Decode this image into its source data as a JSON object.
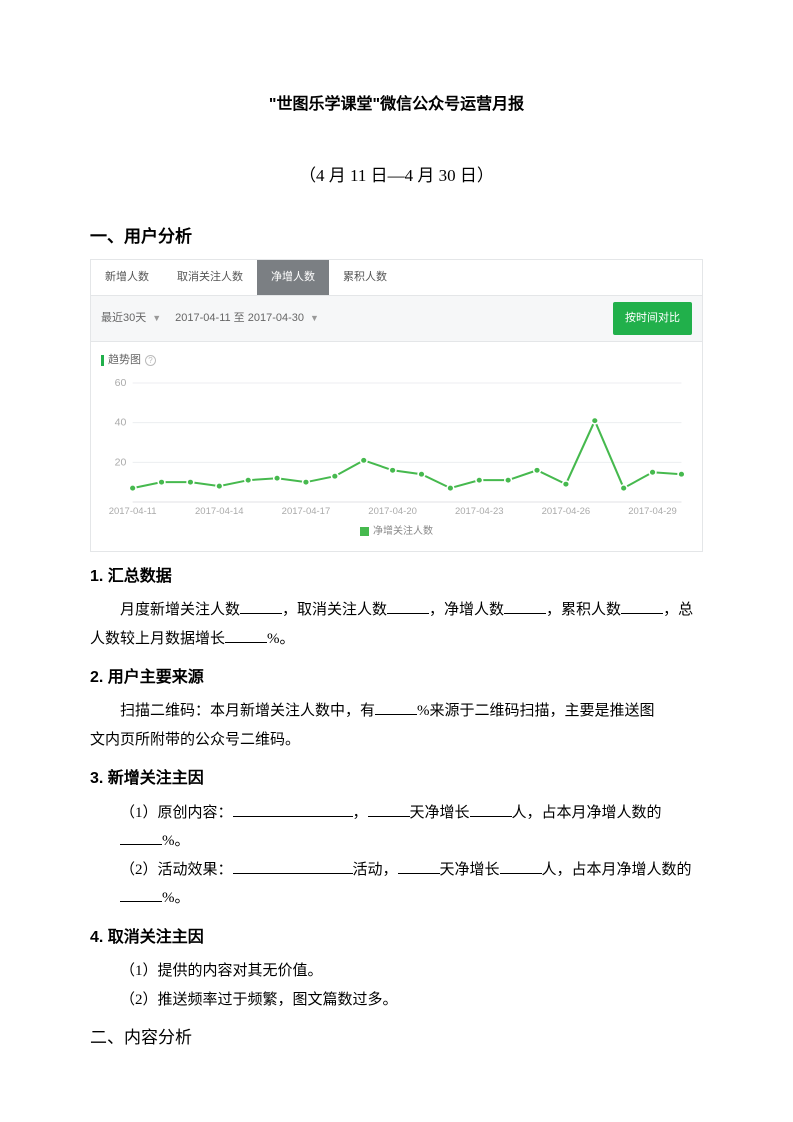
{
  "doc": {
    "title": "\"世图乐学课堂\"微信公众号运营月报",
    "date_range": "（4 月 11 日—4 月 30 日）",
    "section1_heading": "一、用户分析",
    "h_summary": "1. 汇总数据",
    "p_summary_a": "月度新增关注人数",
    "p_summary_b": "，取消关注人数",
    "p_summary_c": "，净增人数",
    "p_summary_d": "，累积人数",
    "p_summary_e": "，总",
    "p_summary_f": "人数较上月数据增长",
    "p_summary_g": "%。",
    "h_source": "2. 用户主要来源",
    "p_source_a": "扫描二维码：本月新增关注人数中，有",
    "p_source_b": "%来源于二维码扫描，主要是推送图",
    "p_source_c": "文内页所附带的公众号二维码。",
    "h_newreason": "3. 新增关注主因",
    "nr1_a": "（1）原创内容：",
    "nr1_b": "，",
    "nr1_c": "天净增长",
    "nr1_d": "人，占本月净增人数的",
    "nr1_e": "%。",
    "nr2_a": "（2）活动效果：",
    "nr2_b": "活动，",
    "nr2_c": "天净增长",
    "nr2_d": "人，占本月净增人数的",
    "nr2_e": "%。",
    "h_cancel": "4. 取消关注主因",
    "cancel1": "（1）提供的内容对其无价值。",
    "cancel2": "（2）推送频率过于频繁，图文篇数过多。",
    "section2_heading": "二、内容分析"
  },
  "chart_ui": {
    "tabs": [
      "新增人数",
      "取消关注人数",
      "净增人数",
      "累积人数"
    ],
    "active_tab_index": 2,
    "range_selector": "最近30天",
    "date_range_label": "2017-04-11 至 2017-04-30",
    "compare_button": "按时间对比",
    "trend_title": "趋势图",
    "legend_label": "净增关注人数"
  },
  "chart_data": {
    "type": "line",
    "title": "趋势图",
    "xlabel": "",
    "ylabel": "",
    "ylim": [
      0,
      60
    ],
    "yticks": [
      20,
      40,
      60
    ],
    "x_tick_labels": [
      "2017-04-11",
      "2017-04-14",
      "2017-04-17",
      "2017-04-20",
      "2017-04-23",
      "2017-04-26",
      "2017-04-29"
    ],
    "series": [
      {
        "name": "净增关注人数",
        "x": [
          "2017-04-11",
          "2017-04-12",
          "2017-04-13",
          "2017-04-14",
          "2017-04-15",
          "2017-04-16",
          "2017-04-17",
          "2017-04-18",
          "2017-04-19",
          "2017-04-20",
          "2017-04-21",
          "2017-04-22",
          "2017-04-23",
          "2017-04-24",
          "2017-04-25",
          "2017-04-26",
          "2017-04-27",
          "2017-04-28",
          "2017-04-29",
          "2017-04-30"
        ],
        "values": [
          7,
          10,
          10,
          8,
          11,
          12,
          10,
          13,
          21,
          16,
          14,
          7,
          11,
          11,
          16,
          9,
          41,
          7,
          15,
          14
        ]
      }
    ]
  }
}
